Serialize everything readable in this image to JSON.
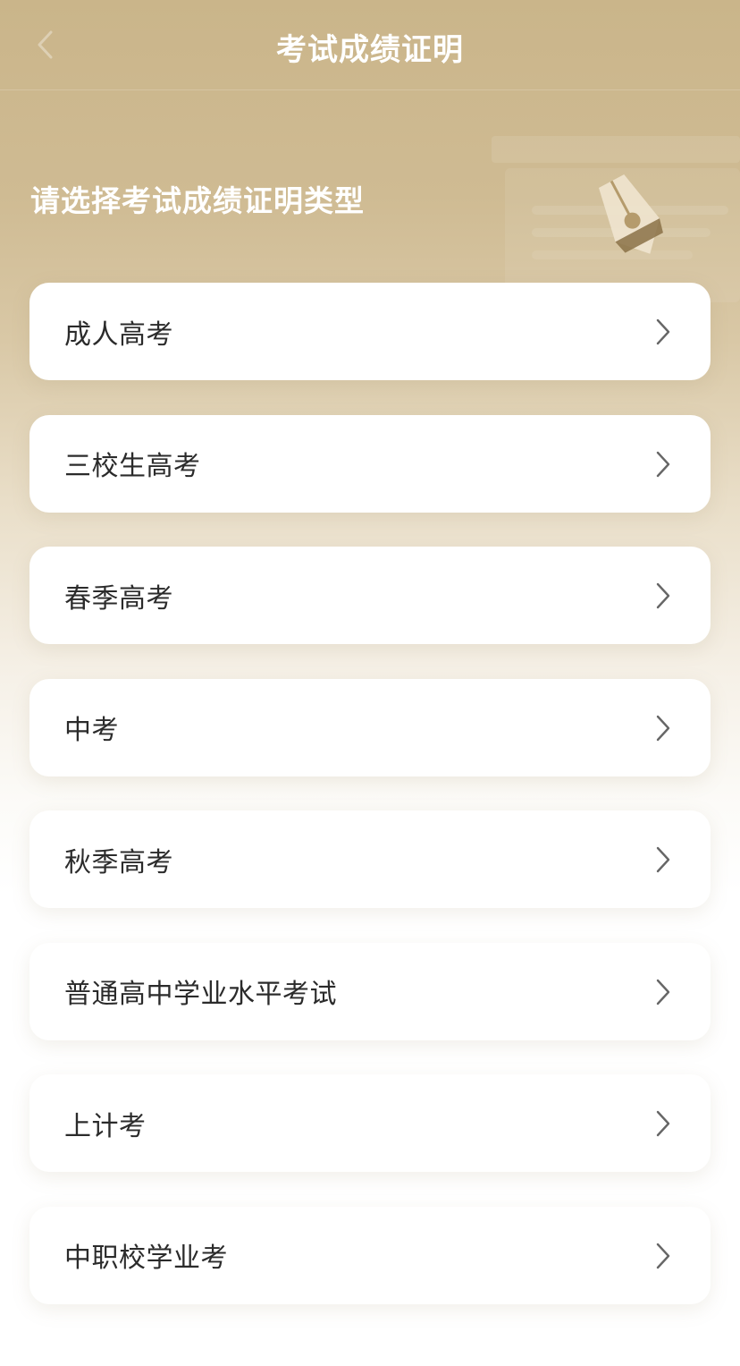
{
  "header": {
    "title": "考试成绩证明"
  },
  "subtitle": "请选择考试成绩证明类型",
  "exam_types": [
    {
      "label": "成人高考"
    },
    {
      "label": "三校生高考"
    },
    {
      "label": "春季高考"
    },
    {
      "label": "中考"
    },
    {
      "label": "秋季高考"
    },
    {
      "label": "普通高中学业水平考试"
    },
    {
      "label": "上计考"
    },
    {
      "label": "中职校学业考"
    }
  ],
  "icons": {
    "back": "chevron-left-icon",
    "item_arrow": "chevron-right-icon",
    "decoration": "fountain-pen-icon"
  },
  "colors": {
    "header_bg": "#cab58a",
    "title_text": "#ffffff",
    "card_bg": "#ffffff",
    "label_text": "#2b2b2b",
    "chevron": "#666666"
  }
}
